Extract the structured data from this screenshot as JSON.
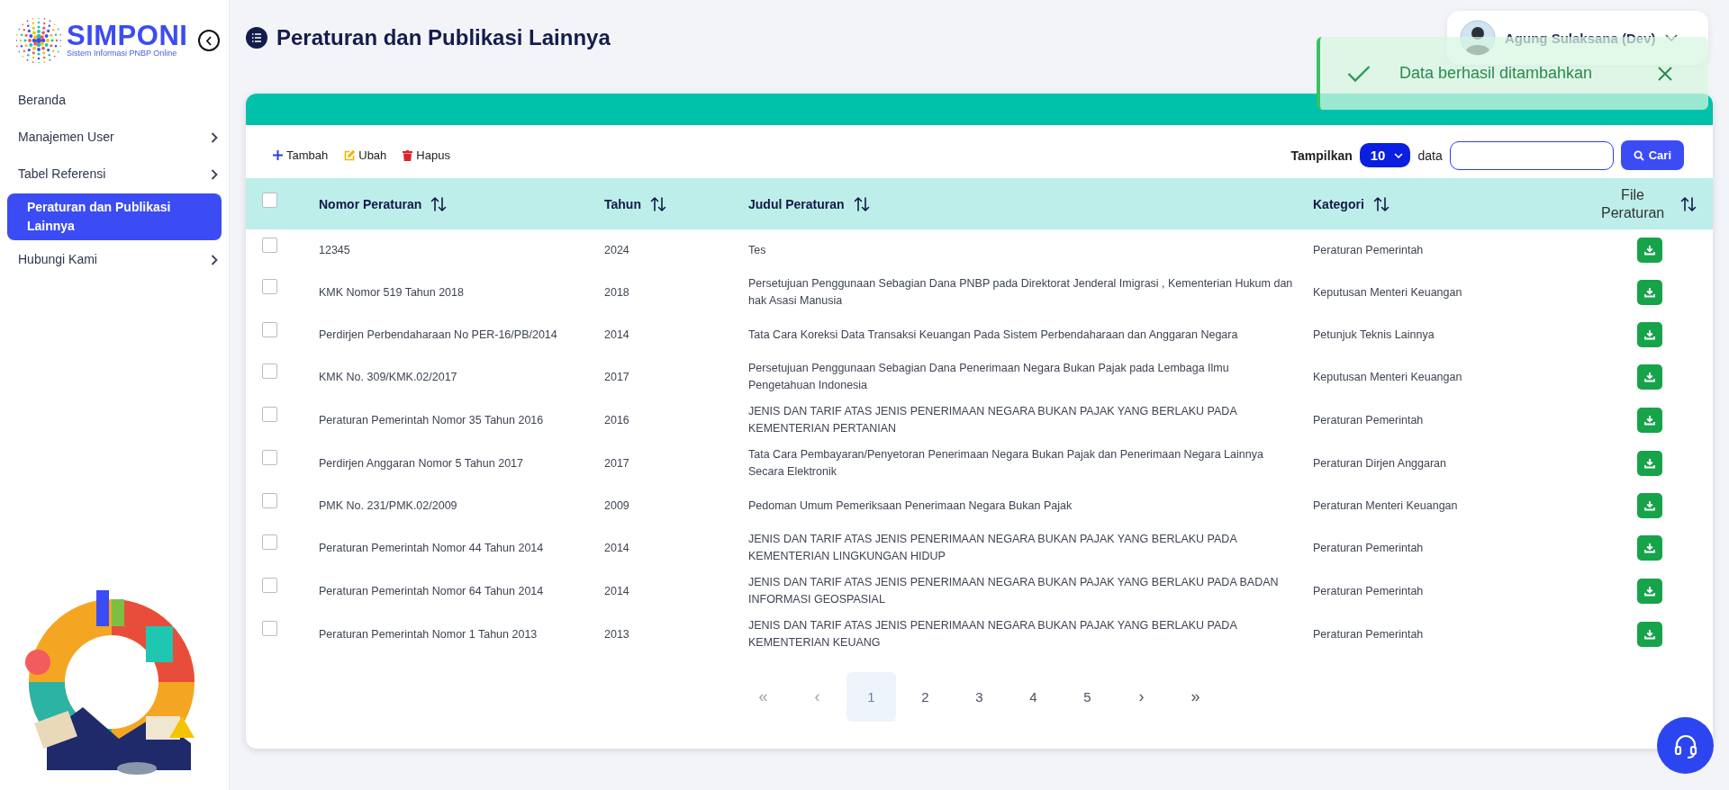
{
  "sidebar": {
    "logo": {
      "title": "SIMPONI",
      "subtitle": "Sistem Informasi PNBP Online"
    },
    "items": [
      {
        "label": "Beranda",
        "selected": false,
        "expandable": false
      },
      {
        "label": "Manajemen User",
        "selected": false,
        "expandable": true
      },
      {
        "label": "Tabel Referensi",
        "selected": false,
        "expandable": true
      },
      {
        "label": "Peraturan dan Publikasi Lainnya",
        "selected": true,
        "expandable": false
      },
      {
        "label": "Hubungi Kami",
        "selected": false,
        "expandable": true
      }
    ]
  },
  "header": {
    "title": "Peraturan dan Publikasi Lainnya",
    "user": {
      "name": "Agung Sulaksana (Dev)"
    }
  },
  "toast": {
    "message": "Data berhasil ditambahkan"
  },
  "toolbar": {
    "actions": [
      {
        "kind": "add",
        "label": "Tambah"
      },
      {
        "kind": "edit",
        "label": "Ubah"
      },
      {
        "kind": "delete",
        "label": "Hapus"
      }
    ],
    "show_label": "Tampilkan",
    "page_size": "10",
    "show_suffix": "data",
    "search_button": "Cari"
  },
  "table": {
    "select_all": {
      "checked": false
    },
    "columns": [
      "Nomor Peraturan",
      "Tahun",
      "Judul Peraturan",
      "Kategori",
      "File Peraturan"
    ],
    "rows": [
      {
        "checked": false,
        "nomor": "12345",
        "tahun": "2024",
        "judul": "Tes",
        "kategori": "Peraturan Pemerintah"
      },
      {
        "checked": false,
        "nomor": "KMK Nomor 519 Tahun 2018",
        "tahun": "2018",
        "judul": "Persetujuan Penggunaan Sebagian Dana PNBP pada Direktorat Jenderal Imigrasi , Kementerian Hukum dan hak Asasi Manusia",
        "kategori": "Keputusan Menteri Keuangan"
      },
      {
        "checked": false,
        "nomor": "Perdirjen Perbendaharaan No PER-16/PB/2014",
        "tahun": "2014",
        "judul": "Tata Cara Koreksi Data Transaksi Keuangan Pada Sistem Perbendaharaan dan Anggaran Negara",
        "kategori": "Petunjuk Teknis Lainnya"
      },
      {
        "checked": false,
        "nomor": "KMK No. 309/KMK.02/2017",
        "tahun": "2017",
        "judul": "Persetujuan Penggunaan Sebagian Dana Penerimaan Negara Bukan Pajak pada Lembaga Ilmu Pengetahuan Indonesia",
        "kategori": "Keputusan Menteri Keuangan"
      },
      {
        "checked": false,
        "nomor": "Peraturan Pemerintah Nomor 35 Tahun 2016",
        "tahun": "2016",
        "judul": "JENIS DAN TARIF ATAS JENIS PENERIMAAN NEGARA BUKAN PAJAK YANG BERLAKU PADA KEMENTERIAN PERTANIAN",
        "kategori": "Peraturan Pemerintah"
      },
      {
        "checked": false,
        "nomor": "Perdirjen Anggaran Nomor 5 Tahun 2017",
        "tahun": "2017",
        "judul": "Tata Cara Pembayaran/Penyetoran Penerimaan Negara Bukan Pajak dan Penerimaan Negara Lainnya Secara Elektronik",
        "kategori": "Peraturan Dirjen Anggaran"
      },
      {
        "checked": false,
        "nomor": "PMK No. 231/PMK.02/2009",
        "tahun": "2009",
        "judul": "Pedoman Umum Pemeriksaan Penerimaan Negara Bukan Pajak",
        "kategori": "Peraturan Menteri Keuangan"
      },
      {
        "checked": false,
        "nomor": "Peraturan Pemerintah Nomor 44 Tahun 2014",
        "tahun": "2014",
        "judul": "JENIS DAN TARIF ATAS JENIS PENERIMAAN NEGARA BUKAN PAJAK YANG BERLAKU PADA KEMENTERIAN LINGKUNGAN HIDUP",
        "kategori": "Peraturan Pemerintah"
      },
      {
        "checked": false,
        "nomor": "Peraturan Pemerintah Nomor 64 Tahun 2014",
        "tahun": "2014",
        "judul": "JENIS DAN TARIF ATAS JENIS PENERIMAAN NEGARA BUKAN PAJAK YANG BERLAKU PADA BADAN INFORMASI GEOSPASIAL",
        "kategori": "Peraturan Pemerintah"
      },
      {
        "checked": false,
        "nomor": "Peraturan Pemerintah Nomor 1 Tahun 2013",
        "tahun": "2013",
        "judul": "JENIS DAN TARIF ATAS JENIS PENERIMAAN NEGARA BUKAN PAJAK YANG BERLAKU PADA KEMENTERIAN KEUANG",
        "kategori": "Peraturan Pemerintah"
      }
    ]
  },
  "pagination": {
    "first": "«",
    "prev": "‹",
    "pages": [
      {
        "label": "1",
        "selected": true
      },
      {
        "label": "2",
        "selected": false
      },
      {
        "label": "3",
        "selected": false
      },
      {
        "label": "4",
        "selected": false
      },
      {
        "label": "5",
        "selected": false
      }
    ],
    "next": "›",
    "last": "»"
  }
}
